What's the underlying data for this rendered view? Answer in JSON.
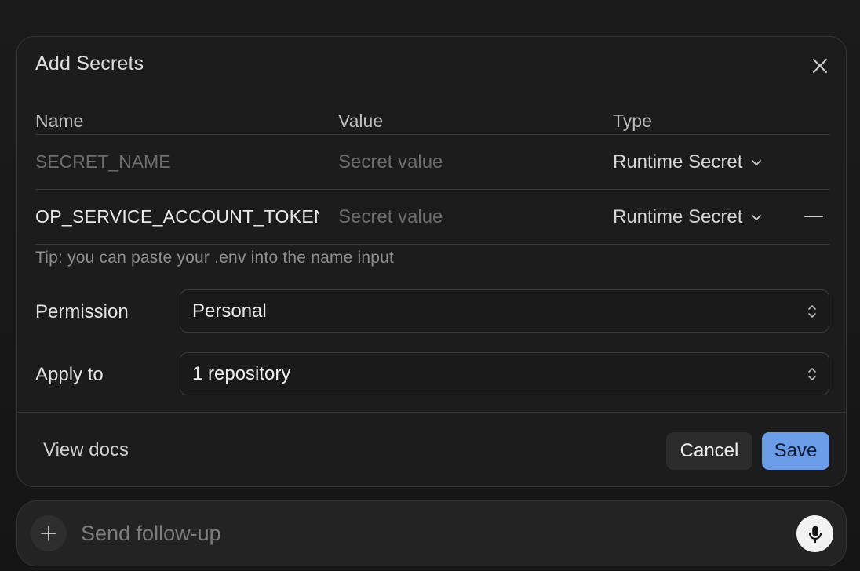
{
  "dialog": {
    "title": "Add Secrets",
    "columns": {
      "name": "Name",
      "value": "Value",
      "type": "Type"
    },
    "rows": [
      {
        "name_value": "",
        "name_placeholder": "SECRET_NAME",
        "value_placeholder": "Secret value",
        "type": "Runtime Secret",
        "removable": false
      },
      {
        "name_value": "OP_SERVICE_ACCOUNT_TOKEN",
        "name_placeholder": "",
        "value_placeholder": "Secret value",
        "type": "Runtime Secret",
        "removable": true
      }
    ],
    "tip": "Tip: you can paste your .env into the name input",
    "permission": {
      "label": "Permission",
      "value": "Personal"
    },
    "apply_to": {
      "label": "Apply to",
      "value": "1 repository"
    },
    "footer": {
      "view_docs": "View docs",
      "cancel": "Cancel",
      "save": "Save"
    }
  },
  "composer": {
    "placeholder": "Send follow-up"
  },
  "icons": {
    "close": "close-icon",
    "chevron": "chevron-down-icon",
    "remove": "minus-icon",
    "updown": "chevron-up-down-icon",
    "plus": "plus-icon",
    "mic": "microphone-icon"
  },
  "colors": {
    "accent": "#6b9ce8",
    "background": "#1c1c1c"
  }
}
